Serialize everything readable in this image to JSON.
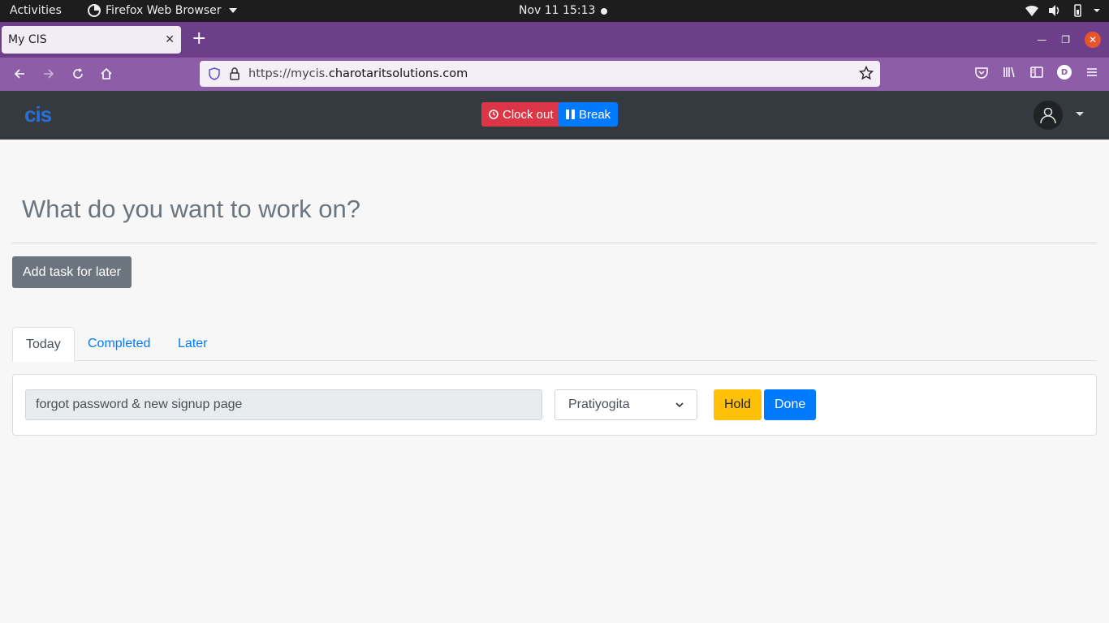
{
  "os_bar": {
    "activities": "Activities",
    "app_name": "Firefox Web Browser",
    "clock": "Nov 11  15:13"
  },
  "browser": {
    "tab_title": "My CIS",
    "url_prefix": "https://mycis.",
    "url_host": "charotaritsolutions.com",
    "profile_initial": "D"
  },
  "app": {
    "logo": "cis",
    "clock_out_label": "Clock out",
    "break_label": "Break"
  },
  "main": {
    "heading": "What do you want to work on?",
    "add_task_label": "Add task for later",
    "tabs": [
      {
        "label": "Today"
      },
      {
        "label": "Completed"
      },
      {
        "label": "Later"
      }
    ],
    "task": {
      "value": "forgot password & new signup page",
      "project": "Pratiyogita",
      "hold_label": "Hold",
      "done_label": "Done"
    }
  },
  "colors": {
    "firefox_tabstrip": "#6d3f8a",
    "firefox_navbar": "#8e5da8",
    "app_header": "#343a40",
    "danger": "#dc3545",
    "primary": "#007bff",
    "warning": "#ffc107",
    "secondary": "#6c757d"
  }
}
